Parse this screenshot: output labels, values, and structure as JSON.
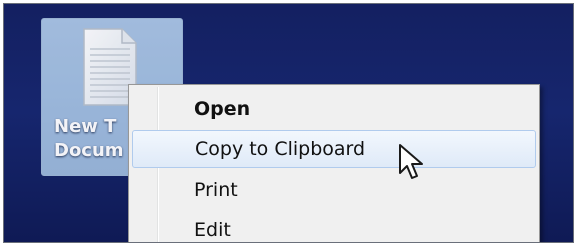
{
  "desktop": {
    "file_icon": {
      "icon": "text-document-icon",
      "label_line1": "New T",
      "label_line2": "Docum"
    }
  },
  "context_menu": {
    "items": [
      {
        "label": "Open",
        "default": true,
        "highlighted": false
      },
      {
        "label": "Copy to Clipboard",
        "default": false,
        "highlighted": true
      },
      {
        "label": "Print",
        "default": false,
        "highlighted": false
      },
      {
        "label": "Edit",
        "default": false,
        "highlighted": false
      }
    ]
  },
  "pointer": {
    "icon": "mouse-pointer-icon"
  },
  "colors": {
    "desktop_background": "#17225e",
    "selection": "#9ab7da",
    "menu_background": "#f0f0f0",
    "menu_hover": "#dfeaf8"
  }
}
